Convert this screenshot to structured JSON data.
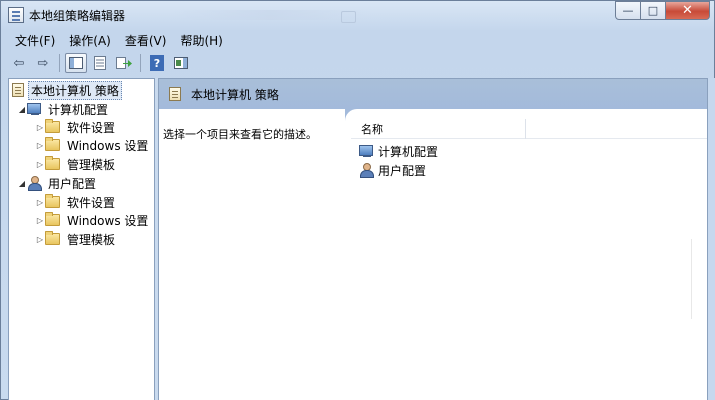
{
  "window": {
    "title": "本地组策略编辑器",
    "controls": {
      "minimize": "—",
      "maximize": "□",
      "close": "✕"
    }
  },
  "menubar": {
    "items": [
      {
        "label": "文件(F)"
      },
      {
        "label": "操作(A)"
      },
      {
        "label": "查看(V)"
      },
      {
        "label": "帮助(H)"
      }
    ]
  },
  "toolbar": {
    "back": "⇦",
    "forward": "⇨",
    "help_glyph": "?"
  },
  "tree": {
    "root": {
      "label": "本地计算机 策略",
      "icon": "policy-doc-icon",
      "selected": true
    },
    "nodes": [
      {
        "label": "计算机配置",
        "icon": "computer-icon",
        "expanded": true
      },
      {
        "label": "软件设置",
        "icon": "folder-icon"
      },
      {
        "label": "Windows 设置",
        "icon": "folder-icon"
      },
      {
        "label": "管理模板",
        "icon": "folder-icon"
      },
      {
        "label": "用户配置",
        "icon": "user-icon",
        "expanded": true
      },
      {
        "label": "软件设置",
        "icon": "folder-icon"
      },
      {
        "label": "Windows 设置",
        "icon": "folder-icon"
      },
      {
        "label": "管理模板",
        "icon": "folder-icon"
      }
    ]
  },
  "details": {
    "header_title": "本地计算机 策略",
    "description": "选择一个项目来查看它的描述。",
    "column_name": "名称",
    "items": [
      {
        "label": "计算机配置",
        "icon": "computer-icon"
      },
      {
        "label": "用户配置",
        "icon": "user-icon"
      }
    ]
  },
  "colors": {
    "frame": "#c6d8ee",
    "header_band": "#a3badb",
    "close_button": "#c74a38"
  }
}
